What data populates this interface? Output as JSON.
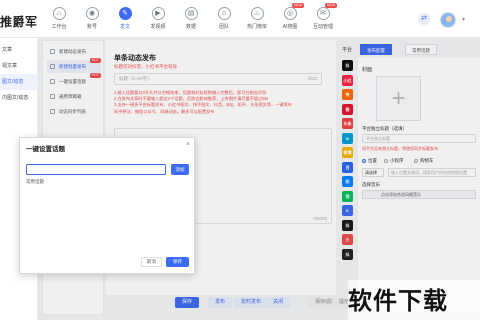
{
  "app": {
    "logo_text": "推爵军"
  },
  "top_nav": [
    {
      "label": "工作台",
      "icon": "home-icon",
      "glyph": "⌂",
      "active": false,
      "new": false
    },
    {
      "label": "账号",
      "icon": "account-icon",
      "glyph": "◉",
      "active": false,
      "new": false
    },
    {
      "label": "发文",
      "icon": "post-icon",
      "glyph": "✎",
      "active": true,
      "new": false
    },
    {
      "label": "发视频",
      "icon": "video-icon",
      "glyph": "▶",
      "active": false,
      "new": false
    },
    {
      "label": "数据",
      "icon": "data-icon",
      "glyph": "▤",
      "active": false,
      "new": false
    },
    {
      "label": "团队",
      "icon": "team-icon",
      "glyph": "☺",
      "active": false,
      "new": false
    },
    {
      "label": "热门榜单",
      "icon": "hot-list-icon",
      "glyph": "♨",
      "active": false,
      "new": false
    },
    {
      "label": "AI搜图",
      "icon": "ai-image-icon",
      "glyph": "◎",
      "active": false,
      "new": true
    },
    {
      "label": "互动管理",
      "icon": "interaction-icon",
      "glyph": "✉",
      "active": false,
      "new": true
    }
  ],
  "new_badge": "NEW",
  "sidebar": [
    {
      "label": "文章",
      "active": false
    },
    {
      "label": "视文章",
      "active": false
    },
    {
      "label": "图文/动态",
      "active": true
    },
    {
      "label": "内图文/动态",
      "active": false
    }
  ],
  "submenu": [
    {
      "label": "新建动态发布",
      "active": false,
      "hot": false
    },
    {
      "label": "新建批量发布",
      "active": true,
      "hot": true
    },
    {
      "label": "一键设置话题",
      "active": false,
      "hot": true
    },
    {
      "label": "通用草稿箱",
      "active": false,
      "hot": false
    },
    {
      "label": "动态同步列表",
      "active": false,
      "hot": false
    }
  ],
  "hot_badge": "HOT",
  "main": {
    "title": "单条动态发布",
    "subtitle": "标题仅对抖音、小红书平台有效",
    "title_placeholder": "标题（0~20字）",
    "title_count": "0/20",
    "tips": [
      "1.输入话题要以#开头并以空格结束，话题和好友昵称输入完整后，即可在前台识别",
      "2.在发布文章时不要输入超过2个话题，否则会影响推荐，上传图片请尽量不超过5M",
      "3.支持一键多平台标题发布、小红书图文、快手图文、抖音、B站、知乎、头条图文等，一键发布",
      "  知乎想法、微信公众号、同城动态。最多可以配置发布"
    ],
    "body_count": "0/5000"
  },
  "bottom_actions": [
    {
      "label": "保存",
      "style": "primary"
    },
    {
      "label": "发布",
      "style": "light"
    },
    {
      "label": "定时发布",
      "style": "light"
    },
    {
      "label": "关闭",
      "style": "light"
    }
  ],
  "bottom_extra": [
    {
      "label": "保存动态"
    },
    {
      "label": "提示"
    }
  ],
  "right": {
    "platform_label": "平台",
    "tabs": [
      {
        "label": "发布配置",
        "active": true
      },
      {
        "label": "常用话题",
        "active": false
      }
    ],
    "platforms": [
      {
        "name": "douyin",
        "abbr": "抖",
        "color": "#111111"
      },
      {
        "name": "xiaohongshu",
        "abbr": "小红",
        "color": "#ff2442"
      },
      {
        "name": "kuaishou",
        "abbr": "快",
        "color": "#ff6a00"
      },
      {
        "name": "weibo",
        "abbr": "微",
        "color": "#e6162d"
      },
      {
        "name": "toutiao",
        "abbr": "头条",
        "color": "#f04142"
      },
      {
        "name": "bilibili",
        "abbr": "B",
        "color": "#00a1d6"
      },
      {
        "name": "weibo2",
        "abbr": "微博",
        "color": "#f7b500"
      },
      {
        "name": "baijia",
        "abbr": "百",
        "color": "#2a65f6"
      },
      {
        "name": "zhihu",
        "abbr": "知",
        "color": "#0084ff"
      },
      {
        "name": "wechat",
        "abbr": "视",
        "color": "#07c160"
      },
      {
        "name": "kuaishou2",
        "abbr": "K",
        "color": "#3d6cf2"
      },
      {
        "name": "douyin2",
        "abbr": "抖",
        "color": "#1c1c1c"
      },
      {
        "name": "huoshan",
        "abbr": "火",
        "color": "#f04c4c"
      },
      {
        "name": "douyin3",
        "abbr": "抖",
        "color": "#222222"
      }
    ],
    "cover_label": "封面",
    "title_field_label": "平台独立标题（选填）",
    "title_field_placeholder": "平台独立标题",
    "title_field_note": "如平台没有独立标题，将使用同步标题发布",
    "radio_options": [
      {
        "label": "位置",
        "checked": true
      },
      {
        "label": "小程序",
        "checked": false
      },
      {
        "label": "购物车",
        "checked": false
      }
    ],
    "location_select": "请选择",
    "location_placeholder": "输入位置关键词，搜索用户所在的地理位置",
    "music_label": "选择音乐",
    "music_value": "点击添加合适风格音乐"
  },
  "modal": {
    "title": "一键设置话题",
    "close": "×",
    "input_value": "",
    "add_label": "添加",
    "common_label": "常用话题",
    "cancel_label": "取消",
    "save_label": "保存"
  },
  "watermark": "软件下载"
}
